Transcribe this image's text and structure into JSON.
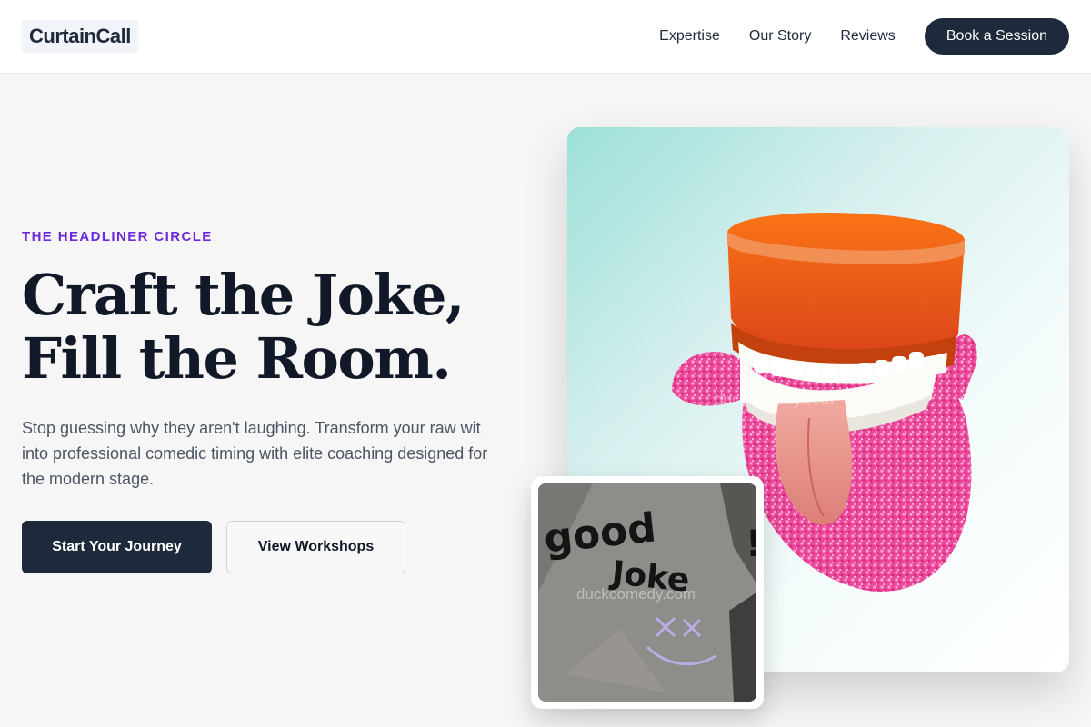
{
  "header": {
    "logo": "CurtainCall",
    "nav": [
      {
        "label": "Expertise"
      },
      {
        "label": "Our Story"
      },
      {
        "label": "Reviews"
      }
    ],
    "cta_label": "Book a Session"
  },
  "hero": {
    "eyebrow": "THE HEADLINER CIRCLE",
    "headline_line1": "Craft the Joke,",
    "headline_line2": "Fill the Room.",
    "description": "Stop guessing why they aren't laughing. Transform your raw wit into professional comedic timing with elite coaching designed for the modern stage.",
    "primary_button": "Start Your Journey",
    "secondary_button": "View Workshops"
  },
  "images": {
    "main_photo": "chattering-teeth-toy",
    "inset_photo": "good-joke-graffiti",
    "inset_graffiti_line1": "good",
    "inset_graffiti_line2": "Joke",
    "watermark": "duckcomedy.com"
  },
  "colors": {
    "primary": "#1e293b",
    "accent": "#6d28d9",
    "background": "#f6f6f6"
  }
}
